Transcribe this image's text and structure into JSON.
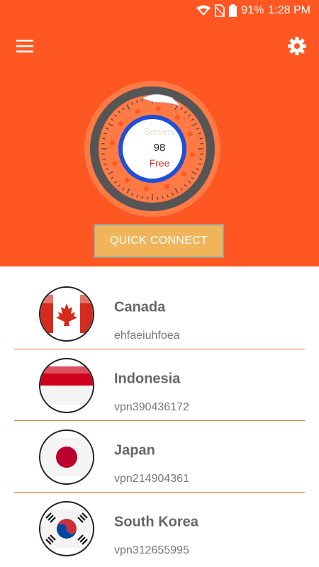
{
  "status_bar": {
    "battery": "91%",
    "time": "1:28 PM",
    "icons": [
      "wifi-icon",
      "no-sim-icon",
      "battery-icon"
    ]
  },
  "app_bar": {
    "menu_icon": "hamburger-menu-icon",
    "settings_icon": "gear-icon"
  },
  "dial": {
    "servers_label": "Servers",
    "servers_count": "98",
    "plan_label": "Free"
  },
  "quick_connect": {
    "label": "QUICK CONNECT"
  },
  "servers": [
    {
      "country": "Canada",
      "server": "ehfaeiuhfoea",
      "flag": "canada-flag-icon"
    },
    {
      "country": "Indonesia",
      "server": "vpn390436172",
      "flag": "indonesia-flag-icon"
    },
    {
      "country": "Japan",
      "server": "vpn214904361",
      "flag": "japan-flag-icon"
    },
    {
      "country": "South Korea",
      "server": "vpn312655995",
      "flag": "south-korea-flag-icon"
    }
  ],
  "colors": {
    "header_bg": "#ff5722",
    "button_bg": "#f0b55a",
    "divider": "#e0722f",
    "free_text": "#d32f2f",
    "ring_blue": "#1e4fd8"
  }
}
